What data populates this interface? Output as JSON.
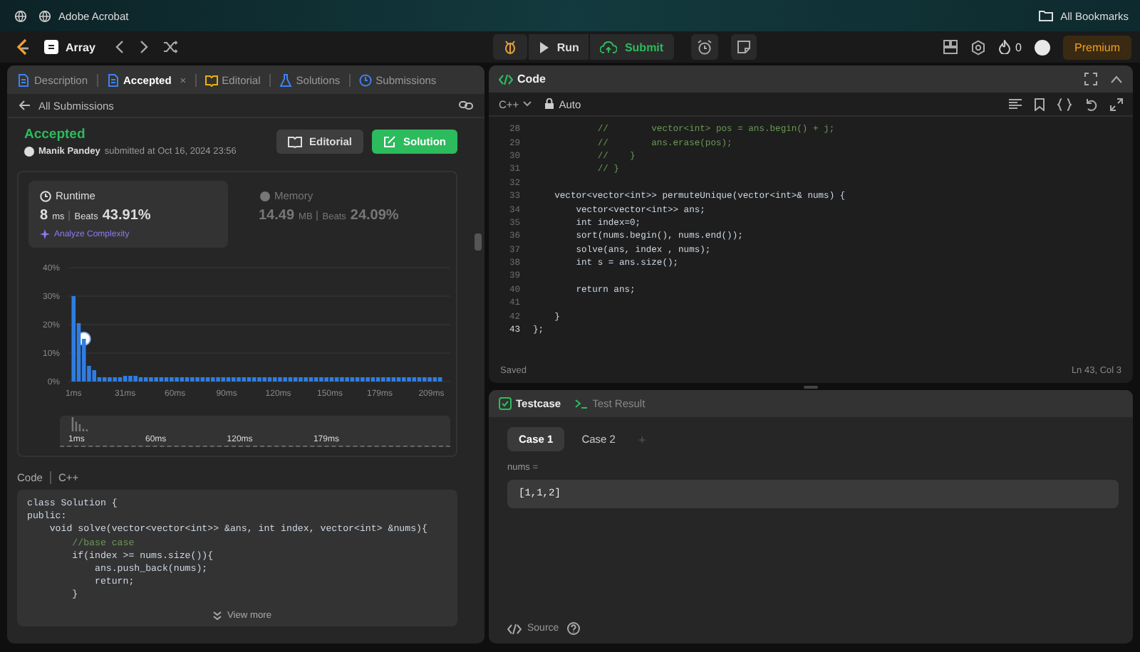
{
  "browser_bar": {
    "bookmark": "Adobe Acrobat",
    "all_bookmarks": "All Bookmarks"
  },
  "nav": {
    "problem_list": "Array",
    "run": "Run",
    "submit": "Submit",
    "streak": "0",
    "premium": "Premium"
  },
  "left_panel": {
    "tabs": [
      {
        "kind": "description",
        "label": "Description",
        "selected": false
      },
      {
        "kind": "result",
        "label": "Accepted",
        "selected": true,
        "close": "×"
      },
      {
        "kind": "editorial",
        "label": "Editorial",
        "selected": false
      },
      {
        "kind": "solutions",
        "label": "Solutions",
        "selected": false
      },
      {
        "kind": "submissions",
        "label": "Submissions",
        "selected": false
      }
    ],
    "back_link": "All Submissions",
    "submission": {
      "status": "Accepted",
      "user": "Manik Pandey",
      "submitted": "submitted at Oct 16, 2024 23:56",
      "editorial_button": "Editorial",
      "solution_button": "Solution"
    },
    "stats": [
      {
        "kind": "runtime",
        "label": "Runtime",
        "value": "8",
        "unit": "ms",
        "beats_label": "Beats",
        "beats": "43.91%",
        "selected": true,
        "link": "Analyze Complexity"
      },
      {
        "kind": "memory",
        "label": "Memory",
        "value": "14.49",
        "unit": "MB",
        "beats_label": "Beats",
        "beats": "24.09%",
        "selected": false
      }
    ],
    "chart_data": {
      "type": "bar",
      "x": [
        1,
        4,
        7,
        10,
        13,
        16,
        19,
        22,
        25,
        28,
        31,
        34,
        37,
        40,
        43,
        46,
        49,
        52,
        55,
        58,
        61,
        64,
        67,
        70,
        73,
        76,
        79,
        82,
        85,
        88,
        91,
        94,
        97,
        100,
        103,
        106,
        109,
        112,
        115,
        118,
        121,
        124,
        127,
        130,
        133,
        136,
        139,
        142,
        145,
        148,
        151,
        154,
        157,
        160,
        163,
        166,
        169,
        172,
        175,
        178,
        181,
        184,
        187,
        190,
        193,
        196,
        199,
        202,
        205,
        208,
        211,
        214
      ],
      "values": [
        30,
        20.5,
        15,
        5.5,
        4,
        1.5,
        1.5,
        1.5,
        1.5,
        1.5,
        2,
        2,
        2,
        1.5,
        1.5,
        1.5,
        1.5,
        1.5,
        1.5,
        1.5,
        1.5,
        1.5,
        1.5,
        1.5,
        1.5,
        1.5,
        1.5,
        1.5,
        1.5,
        1.5,
        1.5,
        1.5,
        1.5,
        1.5,
        1.5,
        1.5,
        1.5,
        1.5,
        1.5,
        1.5,
        1.5,
        1.5,
        1.5,
        1.5,
        1.5,
        1.5,
        1.5,
        1.5,
        1.5,
        1.5,
        1.5,
        1.5,
        1.5,
        1.5,
        1.5,
        1.5,
        1.5,
        1.5,
        1.5,
        1.5,
        1.5,
        1.5,
        1.5,
        1.5,
        1.5,
        1.5,
        1.5,
        1.5,
        1.5,
        1.5,
        1.5,
        1.5
      ],
      "xlim": [
        -2,
        220
      ],
      "ylim": [
        0,
        40
      ],
      "xticks": [
        {
          "value": 1,
          "label": "1ms"
        },
        {
          "value": 31,
          "label": "31ms"
        },
        {
          "value": 60,
          "label": "60ms"
        },
        {
          "value": 90,
          "label": "90ms"
        },
        {
          "value": 120,
          "label": "120ms"
        },
        {
          "value": 150,
          "label": "150ms"
        },
        {
          "value": 179,
          "label": "179ms"
        },
        {
          "value": 209,
          "label": "209ms"
        }
      ],
      "yticks": [
        {
          "value": 0,
          "label": "0%"
        },
        {
          "value": 10,
          "label": "10%"
        },
        {
          "value": 20,
          "label": "20%"
        },
        {
          "value": 30,
          "label": "30%"
        },
        {
          "value": 40,
          "label": "40%"
        }
      ],
      "grid": true
    },
    "navigator_labels": [
      "1ms",
      "60ms",
      "120ms",
      "179ms"
    ],
    "code": {
      "label": "Code",
      "language": "C++",
      "view_more": "View more",
      "lines": [
        {
          "text": "class Solution {",
          "kind": "code"
        },
        {
          "text": "public:",
          "kind": "code"
        },
        {
          "text": "    void solve(vector<vector<int>> &ans, int index, vector<int> &nums){",
          "kind": "code"
        },
        {
          "text": "        //base case",
          "kind": "comment"
        },
        {
          "text": "        if(index >= nums.size()){",
          "kind": "code"
        },
        {
          "text": "            ans.push_back(nums);",
          "kind": "code"
        },
        {
          "text": "            return;",
          "kind": "code"
        },
        {
          "text": "        }",
          "kind": "code"
        }
      ]
    }
  },
  "editor": {
    "title": "Code",
    "language": "C++",
    "mode": "Auto",
    "status": "Saved",
    "cursor": "Ln 43, Col 3",
    "lines": [
      {
        "num": "28",
        "text": "            //        vector<int> pos = ans.begin() + j;",
        "kind": "comment",
        "current": false
      },
      {
        "num": "29",
        "text": "            //        ans.erase(pos);",
        "kind": "comment",
        "current": false
      },
      {
        "num": "30",
        "text": "            //    }",
        "kind": "comment",
        "current": false
      },
      {
        "num": "31",
        "text": "            // }",
        "kind": "comment",
        "current": false
      },
      {
        "num": "32",
        "current": false
      },
      {
        "num": "33",
        "text": "    vector<vector<int>> permuteUnique(vector<int>& nums) {",
        "kind": "code",
        "current": false
      },
      {
        "num": "34",
        "text": "        vector<vector<int>> ans;",
        "kind": "code",
        "current": false
      },
      {
        "num": "35",
        "text": "        int index=0;",
        "kind": "code",
        "current": false
      },
      {
        "num": "36",
        "text": "        sort(nums.begin(), nums.end());",
        "kind": "code",
        "current": false
      },
      {
        "num": "37",
        "text": "        solve(ans, index , nums);",
        "kind": "code",
        "current": false
      },
      {
        "num": "38",
        "text": "        int s = ans.size();",
        "kind": "code",
        "current": false
      },
      {
        "num": "39",
        "current": false
      },
      {
        "num": "40",
        "text": "        return ans;",
        "kind": "code",
        "current": false
      },
      {
        "num": "41",
        "current": false
      },
      {
        "num": "42",
        "text": "    }",
        "kind": "code",
        "current": false
      },
      {
        "num": "43",
        "text": "};",
        "kind": "code",
        "current": true
      }
    ]
  },
  "testcase": {
    "tabs": [
      {
        "kind": "testcase",
        "label": "Testcase",
        "selected": true
      },
      {
        "kind": "result",
        "label": "Test Result",
        "selected": false
      }
    ],
    "cases": [
      {
        "label": "Case 1",
        "selected": true
      },
      {
        "label": "Case 2",
        "selected": false
      }
    ],
    "add": "+",
    "param": "nums =",
    "value": "[1,1,2]",
    "source": "Source"
  }
}
